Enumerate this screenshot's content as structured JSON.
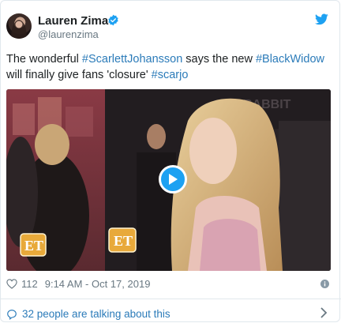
{
  "author": {
    "name": "Lauren Zima",
    "handle": "@laurenzima"
  },
  "tweet": {
    "segments": [
      {
        "text": "The wonderful ",
        "hashtag": false
      },
      {
        "text": "#ScarlettJohansson",
        "hashtag": true
      },
      {
        "text": " says the new ",
        "hashtag": false
      },
      {
        "text": "#BlackWidow",
        "hashtag": true
      },
      {
        "text": " will finally give fans 'closure' ",
        "hashtag": false
      },
      {
        "text": "#scarjo",
        "hashtag": true
      }
    ]
  },
  "media": {
    "type": "video",
    "watermark": "ET",
    "backdrop_text": "RABBIT"
  },
  "footer": {
    "likes": "112",
    "timestamp": "9:14 AM - Oct 17, 2019",
    "talking": "32 people are talking about this"
  },
  "colors": {
    "link": "#2b7bb9",
    "play": "#1da1f2",
    "et_gold": "#e8a93a"
  }
}
